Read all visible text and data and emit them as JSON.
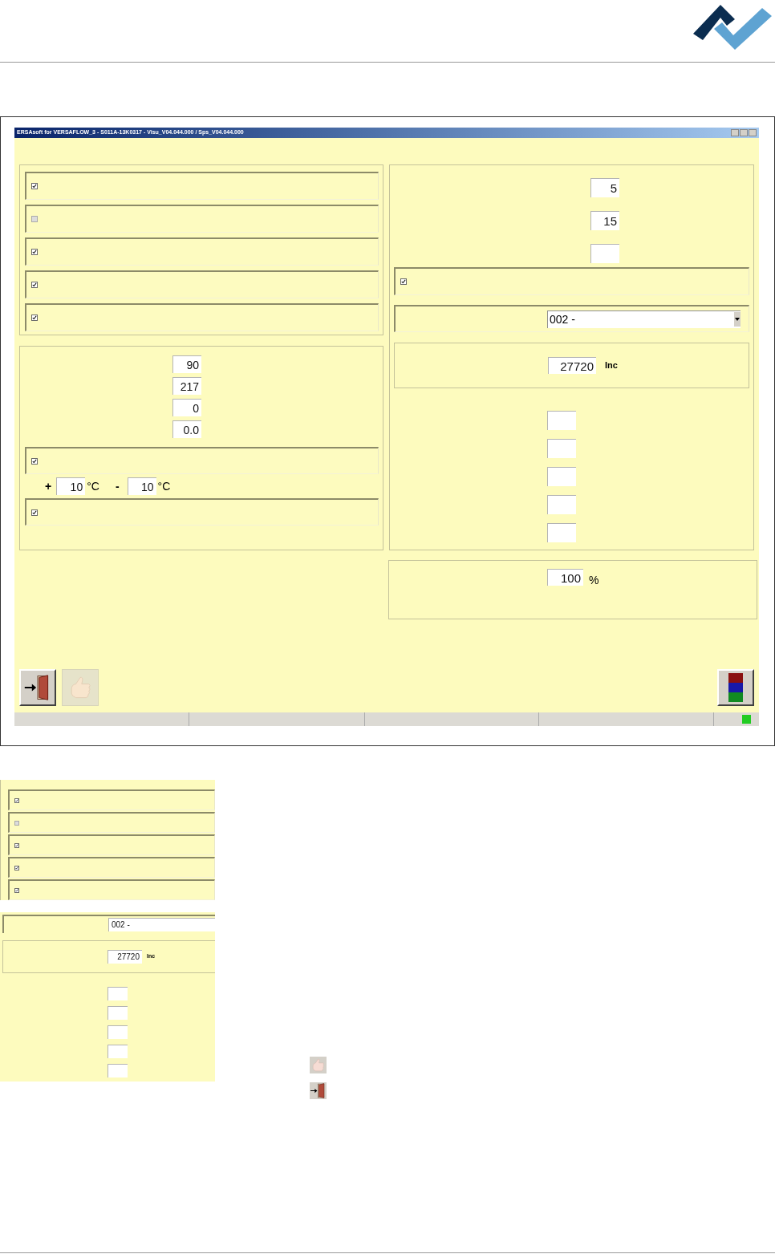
{
  "window": {
    "title": "ERSAsoft for VERSAFLOW_3 - S011A-13K0317 - Visu_V04.044.000 / Sps_V04.044.000"
  },
  "options_group": {
    "rows": [
      {
        "checked": true
      },
      {
        "checked": false
      },
      {
        "checked": true
      },
      {
        "checked": true
      },
      {
        "checked": true
      }
    ]
  },
  "values_group": {
    "fields": [
      "90",
      "217",
      "0",
      "0.0"
    ],
    "checkbox_1": {
      "checked": true
    },
    "plus_sign": "+",
    "plus_value": "10",
    "plus_unit": "°C",
    "minus_sign": "-",
    "minus_value": "10",
    "minus_unit": "°C",
    "checkbox_2": {
      "checked": true
    }
  },
  "right_group": {
    "fields": [
      "5",
      "15"
    ],
    "checkbox": {
      "checked": true
    },
    "dropdown": {
      "value": "002 -"
    },
    "encoder": {
      "value": "27720",
      "unit": "Inc"
    }
  },
  "percent_group": {
    "value": "100",
    "unit": "%"
  },
  "buttons": [
    {
      "kind": "exit",
      "disabled": false
    },
    {
      "kind": "confirm",
      "disabled": true
    }
  ],
  "color_button": {
    "kind": "colors"
  },
  "status_bar": {
    "indicator_on": true
  },
  "detail_1": {
    "rows": [
      {
        "checked": true
      },
      {
        "checked": false
      },
      {
        "checked": true
      },
      {
        "checked": true
      },
      {
        "checked": true
      }
    ]
  },
  "detail_2": {
    "dropdown": {
      "value": "002 -"
    },
    "encoder": {
      "value": "27720",
      "unit": "Inc"
    }
  },
  "legend": [
    {
      "kind": "confirm"
    },
    {
      "kind": "exit"
    }
  ]
}
